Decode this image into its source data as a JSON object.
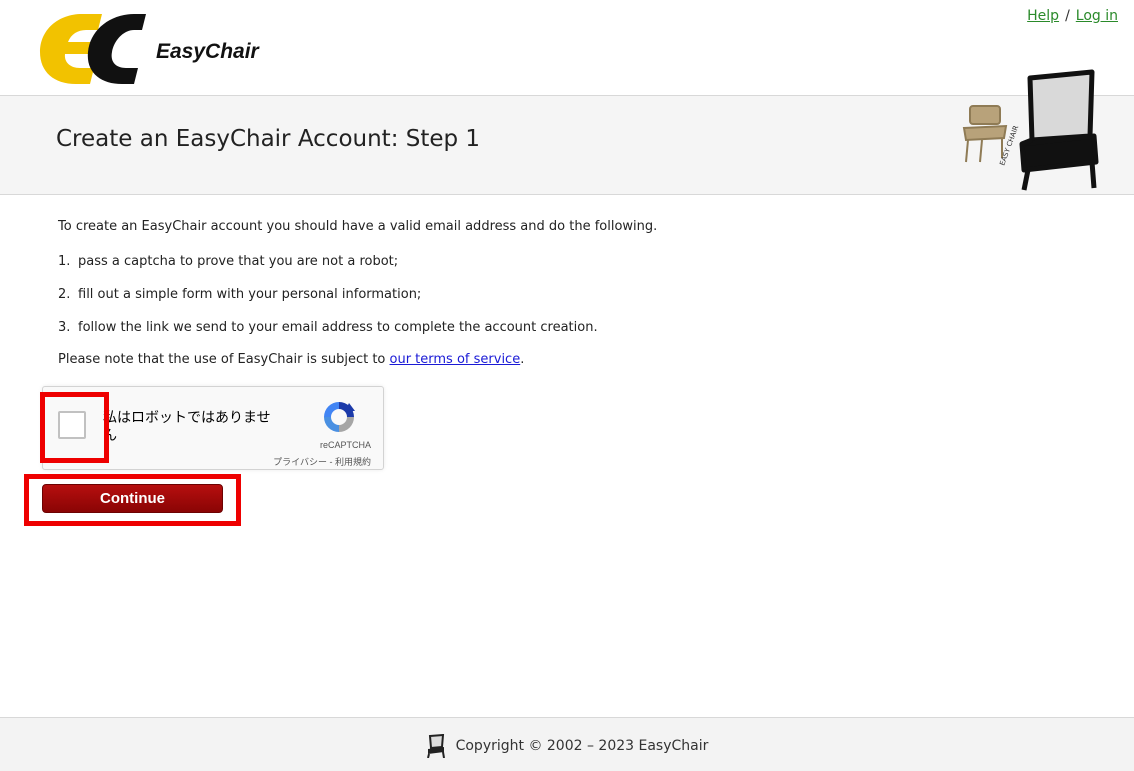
{
  "app": {
    "name": "EasyChair"
  },
  "toplinks": {
    "help": "Help",
    "separator": "/",
    "login": "Log in"
  },
  "header": {
    "title": "Create an EasyChair Account: Step 1"
  },
  "content": {
    "intro": "To create an EasyChair account you should have a valid email address and do the following.",
    "steps": [
      {
        "num": "1.",
        "text": "pass a captcha to prove that you are not a robot;"
      },
      {
        "num": "2.",
        "text": "fill out a simple form with your personal information;"
      },
      {
        "num": "3.",
        "text": "follow the link we send to your email address to complete the account creation."
      }
    ],
    "terms_prefix": "Please note that the use of EasyChair is subject to ",
    "terms_link": "our terms of service",
    "terms_suffix": "."
  },
  "recaptcha": {
    "label": "私はロボットではありません",
    "brand": "reCAPTCHA",
    "privacy": "プライバシー",
    "links_sep": " - ",
    "terms": "利用規約"
  },
  "continue_button": {
    "label": "Continue"
  },
  "footer": {
    "copyright": "Copyright © 2002 – 2023 EasyChair"
  },
  "colors": {
    "logo_yellow": "#f2c200",
    "link_green": "#2a8a2a",
    "link_blue": "#1a1ad6",
    "button_red": "#9e0a0a",
    "highlight_red": "#ee0000"
  }
}
